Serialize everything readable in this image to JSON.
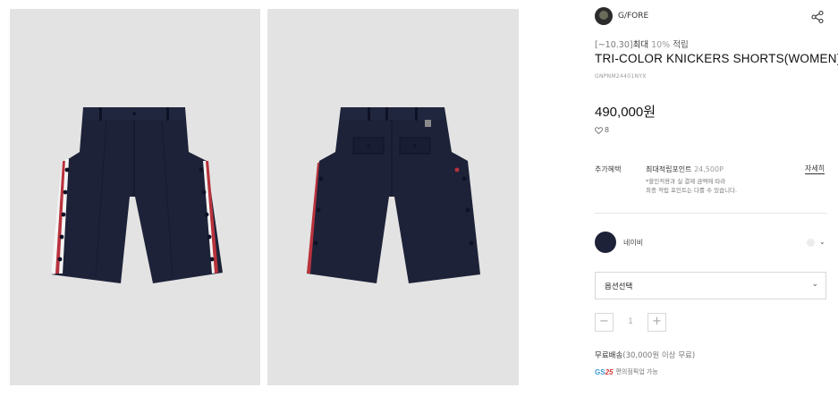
{
  "brand": {
    "name": "G/FORE"
  },
  "promo": {
    "dates": "[~10.30]",
    "max": "최대",
    "pct": "10%",
    "word": "적립"
  },
  "product": {
    "title": "TRI-COLOR KNICKERS SHORTS(WOMEN)",
    "code": "GNPNM24401NYX",
    "price": "490,000원",
    "likes": "8"
  },
  "benefit": {
    "label": "추가혜택",
    "main": "최대적립포인트",
    "points": "24,500P",
    "note_line1": "*할인적용과 실 결제 금액에 따라",
    "note_line2": "최종 적립 포인트는 다를 수 있습니다.",
    "details_link": "자세히"
  },
  "color_option": {
    "label": "네이비",
    "swatch_color": "#1d2238"
  },
  "option_select": {
    "label": "옵션선택"
  },
  "quantity": {
    "value": "1",
    "minus": "−",
    "plus": "+"
  },
  "shipping": {
    "label": "무료배송",
    "condition": "(30,000원 이상 무료)"
  },
  "gs25": {
    "text": "편의점픽업 가능",
    "logo_gs": "GS",
    "logo_num": "25"
  },
  "colors": {
    "navy": "#1d2238",
    "stripe_red": "#b8323c",
    "panel_bg": "#e3e3e3"
  }
}
